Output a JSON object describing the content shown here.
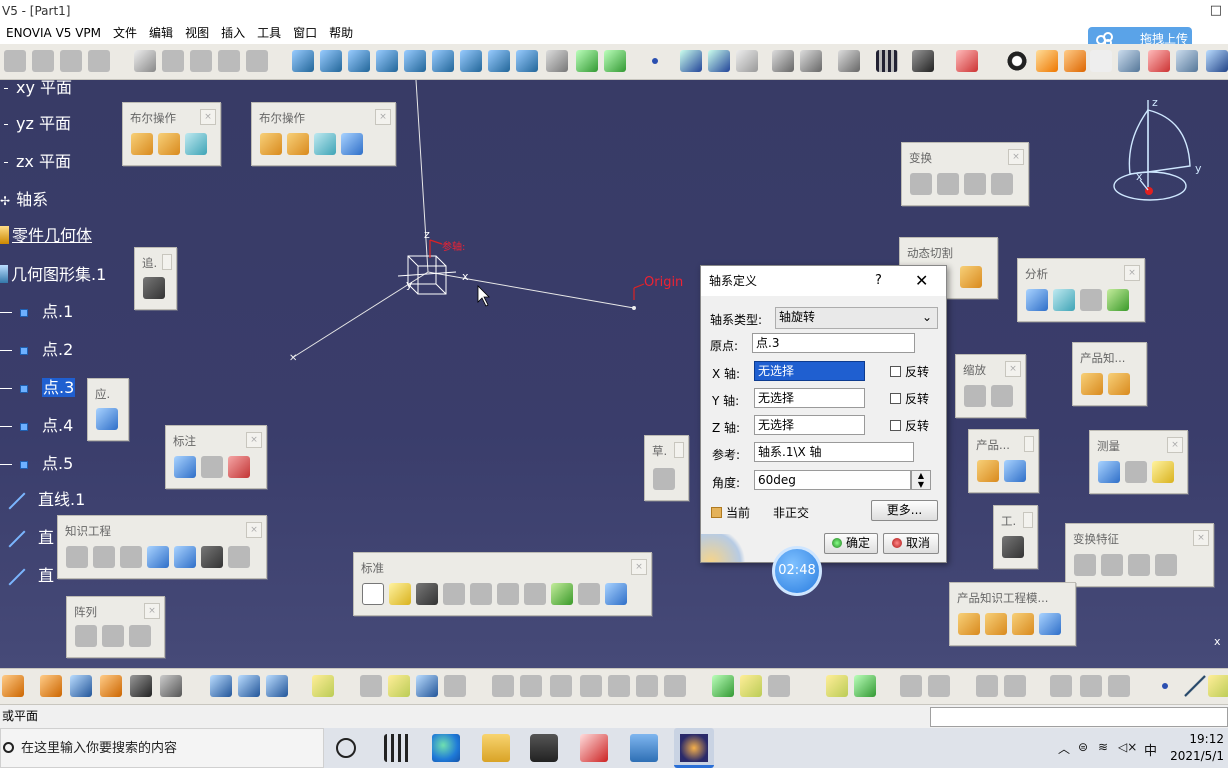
{
  "window": {
    "title": "V5 - [Part1]",
    "restore_glyph": "□"
  },
  "menu": [
    "ENOVIA V5 VPM",
    "文件",
    "编辑",
    "视图",
    "插入",
    "工具",
    "窗口",
    "帮助"
  ],
  "upload_button": "拖拽上传",
  "tree": {
    "items": [
      {
        "label": "xy 平面",
        "type": "plane"
      },
      {
        "label": "yz 平面",
        "type": "plane"
      },
      {
        "label": "zx 平面",
        "type": "plane"
      },
      {
        "label": "轴系",
        "type": "axis"
      },
      {
        "label": "零件几何体",
        "type": "body"
      },
      {
        "label": "几何图形集.1",
        "type": "set"
      },
      {
        "label": "点.1",
        "type": "point"
      },
      {
        "label": "点.2",
        "type": "point"
      },
      {
        "label": "点.3",
        "type": "point",
        "selected": true
      },
      {
        "label": "点.4",
        "type": "point"
      },
      {
        "label": "点.5",
        "type": "point"
      },
      {
        "label": "直线.1",
        "type": "line"
      },
      {
        "label": "直",
        "type": "line"
      },
      {
        "label": "直",
        "type": "line"
      }
    ]
  },
  "viewport_labels": {
    "origin": "Origin",
    "x": "x",
    "z": "z",
    "y": "y",
    "compass_z": "z",
    "compass_y": "y",
    "compass_x": "x",
    "edge_x": "x",
    "ref_label": "参轴:"
  },
  "panels": {
    "boolean1": {
      "title": "布尔操作"
    },
    "boolean2": {
      "title": "布尔操作"
    },
    "track": {
      "title": "追."
    },
    "apply": {
      "title": "应."
    },
    "annotation": {
      "title": "标注"
    },
    "knowledge": {
      "title": "知识工程"
    },
    "array": {
      "title": "阵列"
    },
    "standard": {
      "title": "标准"
    },
    "sketch": {
      "title": "草."
    },
    "transform": {
      "title": "变换"
    },
    "dynamic_cut": {
      "title": "动态切割"
    },
    "analysis": {
      "title": "分析"
    },
    "scale": {
      "title": "缩放"
    },
    "product_knowledge": {
      "title": "产品知..."
    },
    "product": {
      "title": "产品..."
    },
    "measure": {
      "title": "测量"
    },
    "tool": {
      "title": "工."
    },
    "transform_feature": {
      "title": "变换特征"
    },
    "product_knowledge_template": {
      "title": "产品知识工程模..."
    }
  },
  "dialog": {
    "title": "轴系定义",
    "help": "?",
    "close": "✕",
    "type_label": "轴系类型:",
    "type_value": "轴旋转",
    "origin_label": "原点:",
    "origin_value": "点.3",
    "x_label": "X 轴:",
    "x_value": "无选择",
    "y_label": "Y 轴:",
    "y_value": "无选择",
    "z_label": "Z 轴:",
    "z_value": "无选择",
    "reverse": "反转",
    "ref_label": "参考:",
    "ref_value": "轴系.1\\X 轴",
    "angle_label": "角度:",
    "angle_value": "60deg",
    "current_label": "当前",
    "nonortho_label": "非正交",
    "more_button": "更多...",
    "ok_button": "确定",
    "cancel_button": "取消"
  },
  "timer": "02:48",
  "status": {
    "text": "或平面"
  },
  "taskbar": {
    "search_placeholder": "在这里输入你要搜索的内容",
    "time": "19:12",
    "date": "2021/5/1",
    "ime": "中"
  }
}
